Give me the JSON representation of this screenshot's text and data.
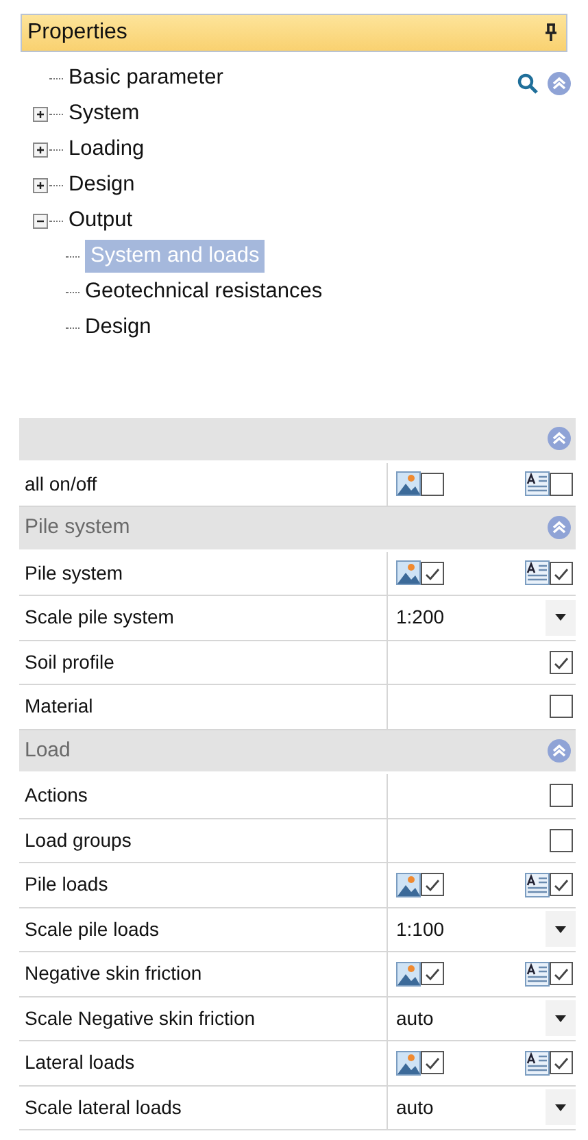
{
  "panel": {
    "title": "Properties"
  },
  "tree": [
    {
      "label": "Basic parameter",
      "kind": "leaf"
    },
    {
      "label": "System",
      "kind": "node",
      "expanded": false
    },
    {
      "label": "Loading",
      "kind": "node",
      "expanded": false
    },
    {
      "label": "Design",
      "kind": "node",
      "expanded": false
    },
    {
      "label": "Output",
      "kind": "node",
      "expanded": true,
      "children": [
        {
          "label": "System and loads",
          "selected": true
        },
        {
          "label": "Geotechnical resistances",
          "selected": false
        },
        {
          "label": "Design",
          "selected": false
        }
      ]
    }
  ],
  "grid": [
    {
      "kind": "group",
      "expanded": true
    },
    {
      "kind": "toggle",
      "label": "all on/off",
      "graphic": false,
      "text": false
    },
    {
      "kind": "group",
      "label": "Pile system",
      "expanded": true
    },
    {
      "kind": "toggle",
      "label": "Pile system",
      "graphic": true,
      "text": true
    },
    {
      "kind": "select",
      "label": "Scale pile system",
      "value": "1:200"
    },
    {
      "kind": "check",
      "label": "Soil profile",
      "checked": true
    },
    {
      "kind": "check",
      "label": "Material",
      "checked": false
    },
    {
      "kind": "group",
      "label": "Load",
      "expanded": true
    },
    {
      "kind": "check",
      "label": "Actions",
      "checked": false
    },
    {
      "kind": "check",
      "label": "Load groups",
      "checked": false
    },
    {
      "kind": "toggle",
      "label": "Pile loads",
      "graphic": true,
      "text": true
    },
    {
      "kind": "select",
      "label": "Scale pile loads",
      "value": "1:100"
    },
    {
      "kind": "toggle",
      "label": "Negative skin friction",
      "graphic": true,
      "text": true
    },
    {
      "kind": "select",
      "label": "Scale Negative skin friction",
      "value": "auto"
    },
    {
      "kind": "toggle",
      "label": "Lateral loads",
      "graphic": true,
      "text": true
    },
    {
      "kind": "select",
      "label": "Scale lateral loads",
      "value": "auto"
    }
  ]
}
